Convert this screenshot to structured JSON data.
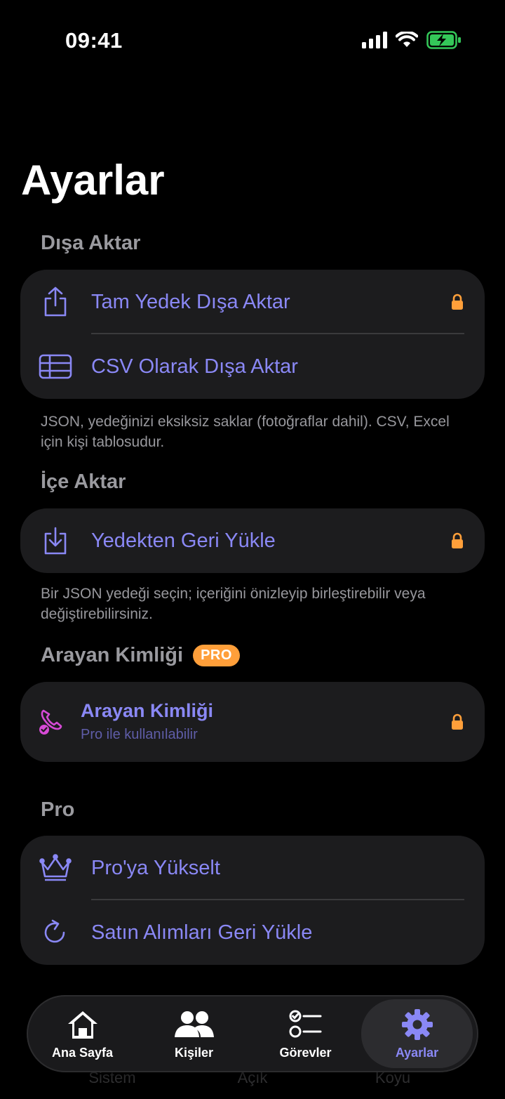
{
  "status_bar": {
    "time": "09:41"
  },
  "page": {
    "title": "Ayarlar"
  },
  "export_section": {
    "header": "Dışa Aktar",
    "items": [
      {
        "label": "Tam Yedek Dışa Aktar",
        "icon": "share-icon",
        "locked": true
      },
      {
        "label": "CSV Olarak Dışa Aktar",
        "icon": "table-icon",
        "locked": false
      }
    ],
    "footnote": "JSON, yedeğinizi eksiksiz saklar (fotoğraflar dahil). CSV, Excel için kişi tablosudur."
  },
  "import_section": {
    "header": "İçe Aktar",
    "items": [
      {
        "label": "Yedekten Geri Yükle",
        "icon": "download-icon",
        "locked": true
      }
    ],
    "footnote": "Bir JSON yedeği seçin; içeriğini önizleyip birleştirebilir veya değiştirebilirsiniz."
  },
  "caller_id_section": {
    "header": "Arayan Kimliği",
    "badge": "PRO",
    "item": {
      "title": "Arayan Kimliği",
      "subtitle": "Pro ile kullanılabilir",
      "icon": "phone-check-icon",
      "locked": true
    }
  },
  "pro_section": {
    "header": "Pro",
    "items": [
      {
        "label": "Pro'ya Yükselt",
        "icon": "crown-icon"
      },
      {
        "label": "Satın Alımları Geri Yükle",
        "icon": "refresh-icon"
      }
    ]
  },
  "tab_bar": {
    "tabs": [
      {
        "label": "Ana Sayfa",
        "icon": "home-icon",
        "active": false
      },
      {
        "label": "Kişiler",
        "icon": "people-icon",
        "active": false
      },
      {
        "label": "Görevler",
        "icon": "checklist-icon",
        "active": false
      },
      {
        "label": "Ayarlar",
        "icon": "gear-icon",
        "active": true
      }
    ]
  },
  "appearance_segment": {
    "options": [
      "Sistem",
      "Açık",
      "Koyu"
    ]
  },
  "colors": {
    "accent": "#8a88f5",
    "lock": "#ff9f3a",
    "card": "#1c1c1e",
    "badge": "#ff9f3a",
    "caller_icon": "#d64ad6",
    "battery": "#34c759"
  }
}
